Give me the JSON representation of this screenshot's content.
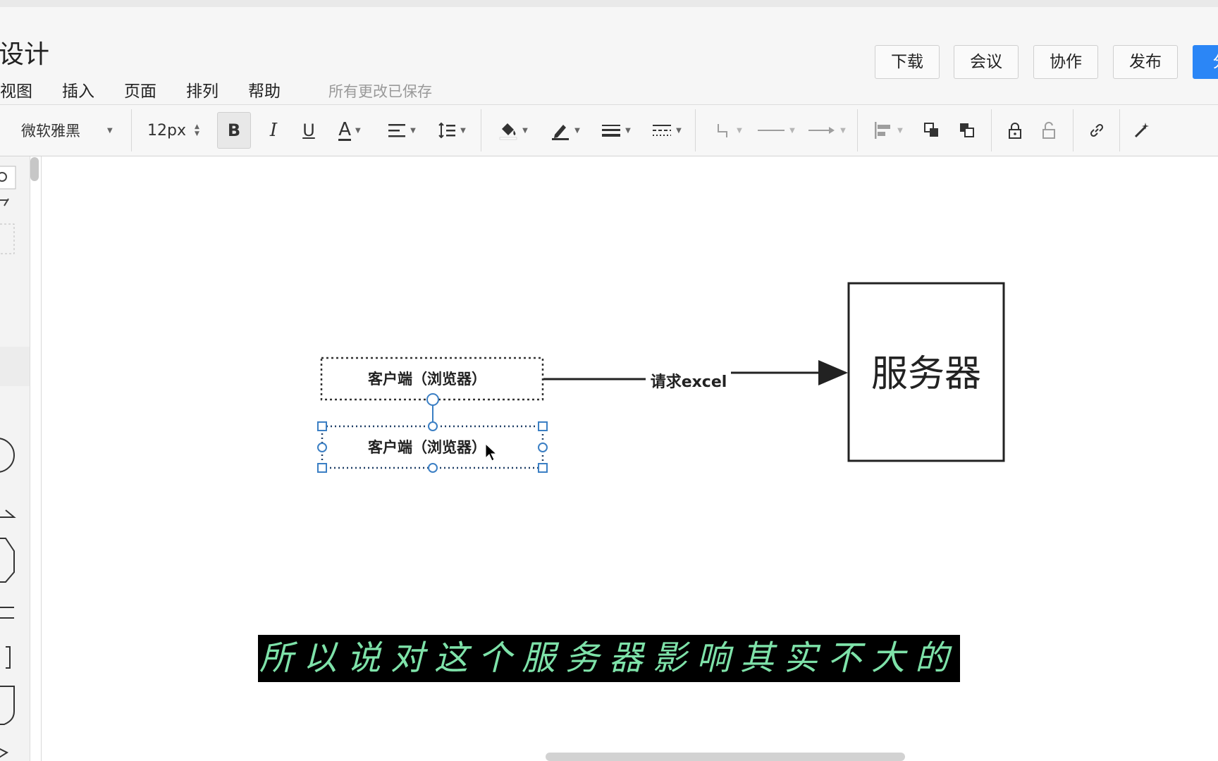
{
  "app": {
    "doc_title": "设计",
    "menu": [
      "视图",
      "插入",
      "页面",
      "排列",
      "帮助"
    ],
    "save_status": "所有更改已保存",
    "buttons": {
      "download": "下载",
      "meeting": "会议",
      "collaborate": "协作",
      "publish": "发布",
      "share": "分"
    }
  },
  "toolbar": {
    "font_family": "微软雅黑",
    "font_size": "12px",
    "bold": "B",
    "italic": "I",
    "underline": "U",
    "font_color": "A"
  },
  "diagram": {
    "node_client_top": "客户端（浏览器）",
    "node_client_selected": "客户端（浏览器）",
    "edge_label": "请求excel",
    "node_server": "服务器"
  },
  "subtitle": "所以说对这个服务器影响其实不大的",
  "colors": {
    "accent": "#2b86f6",
    "selection": "#3b7fc4",
    "subtitle_text": "#7ee2a9"
  }
}
